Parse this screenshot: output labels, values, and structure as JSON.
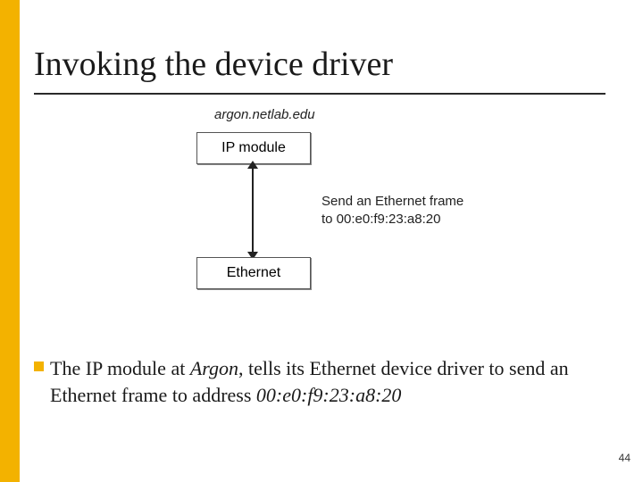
{
  "title": "Invoking the device driver",
  "diagram": {
    "host_label": "argon.netlab.edu",
    "box_ip": "IP module",
    "box_eth": "Ethernet",
    "side_label_line1": "Send an Ethernet frame",
    "side_label_line2": "to 00:e0:f9:23:a8:20"
  },
  "body": {
    "pre": "The IP module at ",
    "argon": "Argon",
    "mid": ", tells its Ethernet device driver to send an ",
    "eth_frame": "Ethernet frame",
    "post1": "  to address ",
    "mac": "00:e0:f9:23:a8:20"
  },
  "slide_number": "44"
}
